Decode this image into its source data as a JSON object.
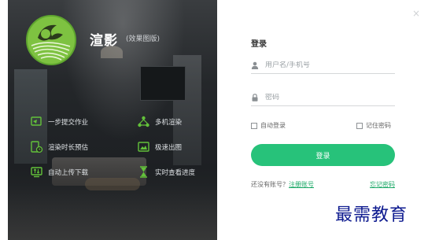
{
  "brand": {
    "name": "渲影",
    "subtitle": "(效果图版)"
  },
  "features": [
    {
      "label": "一步提交作业",
      "icon": "send-icon"
    },
    {
      "label": "多机渲染",
      "icon": "multi-machine-icon"
    },
    {
      "label": "渲染时长预估",
      "icon": "time-estimate-icon"
    },
    {
      "label": "极速出图",
      "icon": "fast-image-icon"
    },
    {
      "label": "自动上传下载",
      "icon": "upload-download-icon"
    },
    {
      "label": "实时查看进度",
      "icon": "hourglass-icon"
    }
  ],
  "login": {
    "close_icon": "×",
    "title": "登录",
    "username_placeholder": "用户名/手机号",
    "password_placeholder": "密码",
    "auto_login_label": "自动登录",
    "remember_password_label": "记住密码",
    "submit_label": "登录",
    "no_account_text": "还没有账号？",
    "register_link": "注册账号",
    "forgot_link": "忘记密码"
  },
  "watermark": "最需教育",
  "colors": {
    "accent": "#27c27a",
    "link": "#1aa866",
    "feature_icon": "#63c23a"
  }
}
